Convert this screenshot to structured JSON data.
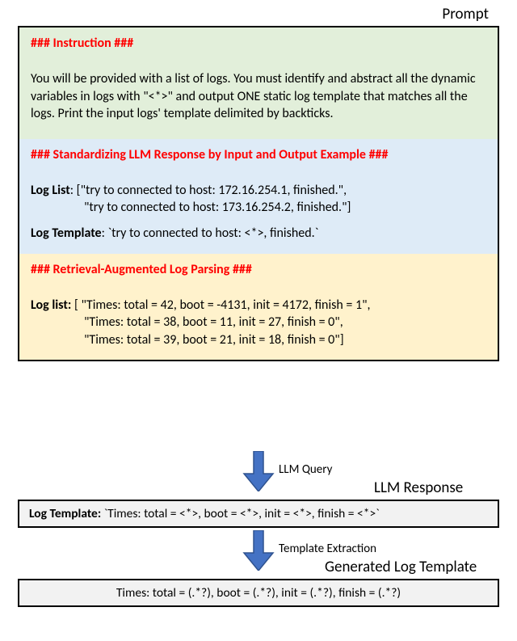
{
  "labels": {
    "prompt": "Prompt",
    "llm_response": "LLM Response",
    "generated_template": "Generated Log Template",
    "arrow1": "LLM Query",
    "arrow2": "Template Extraction"
  },
  "instruction": {
    "heading": "### Instruction ###",
    "body": "You will be provided with a list of logs. You must identify and abstract all the dynamic variables in logs with \"<*>\" and output ONE static log template that matches all the logs. Print the input logs' template delimited by backticks."
  },
  "standardizing": {
    "heading": "### Standardizing LLM Response by Input and Output Example ###",
    "loglist_label": "Log List",
    "loglist_line1": ": [\"try to connected to host: 172.16.254.1, finished.\",",
    "loglist_line2": "\"try to connected to host: 173.16.254.2, finished.\"]",
    "template_label": "Log Template",
    "template_value": ": `try to connected to host: <*>, finished.`"
  },
  "retrieval": {
    "heading": "### Retrieval-Augmented Log Parsing ###",
    "loglist_label": "Log list:",
    "line1": " [ \"Times: total = 42, boot = -4131, init = 4172, finish = 1\",",
    "line2": "\"Times: total = 38, boot = 11, init = 27, finish = 0\",",
    "line3": "\"Times: total = 39, boot = 21, init = 18, finish = 0\"]"
  },
  "response": {
    "label": "Log Template:",
    "value": " `Times: total = <*>, boot = <*>, init = <*>, finish = <*>`"
  },
  "generated": {
    "value": "Times: total = (.*?), boot = (.*?), init = (.*?), finish = (.*?)"
  },
  "colors": {
    "heading_red": "#ff0000",
    "sec_green": "#e2efda",
    "sec_blue": "#deebf7",
    "sec_yellow": "#fff2cc",
    "result_gray": "#f2f2f2",
    "arrow_fill": "#4472c4",
    "arrow_stroke": "#2f528f"
  }
}
